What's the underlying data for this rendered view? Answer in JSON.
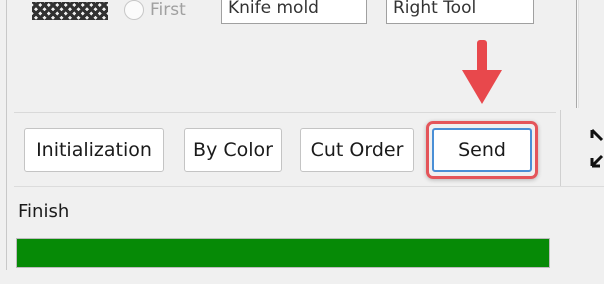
{
  "options": {
    "radio_label": "First",
    "field1_value": "Knife mold",
    "field2_value": "Right Tool"
  },
  "toolbar": {
    "initialization_label": "Initialization",
    "by_color_label": "By Color",
    "cut_order_label": "Cut Order",
    "send_label": "Send"
  },
  "annotation": {
    "arrow_color": "#e8484c",
    "highlight_color": "#e4555a"
  },
  "status": {
    "text": "Finish",
    "progress_fraction": 1.0,
    "progress_color": "#068a06"
  },
  "icons": {
    "pattern": "checker-pattern-icon",
    "expand": "expand-icon"
  }
}
